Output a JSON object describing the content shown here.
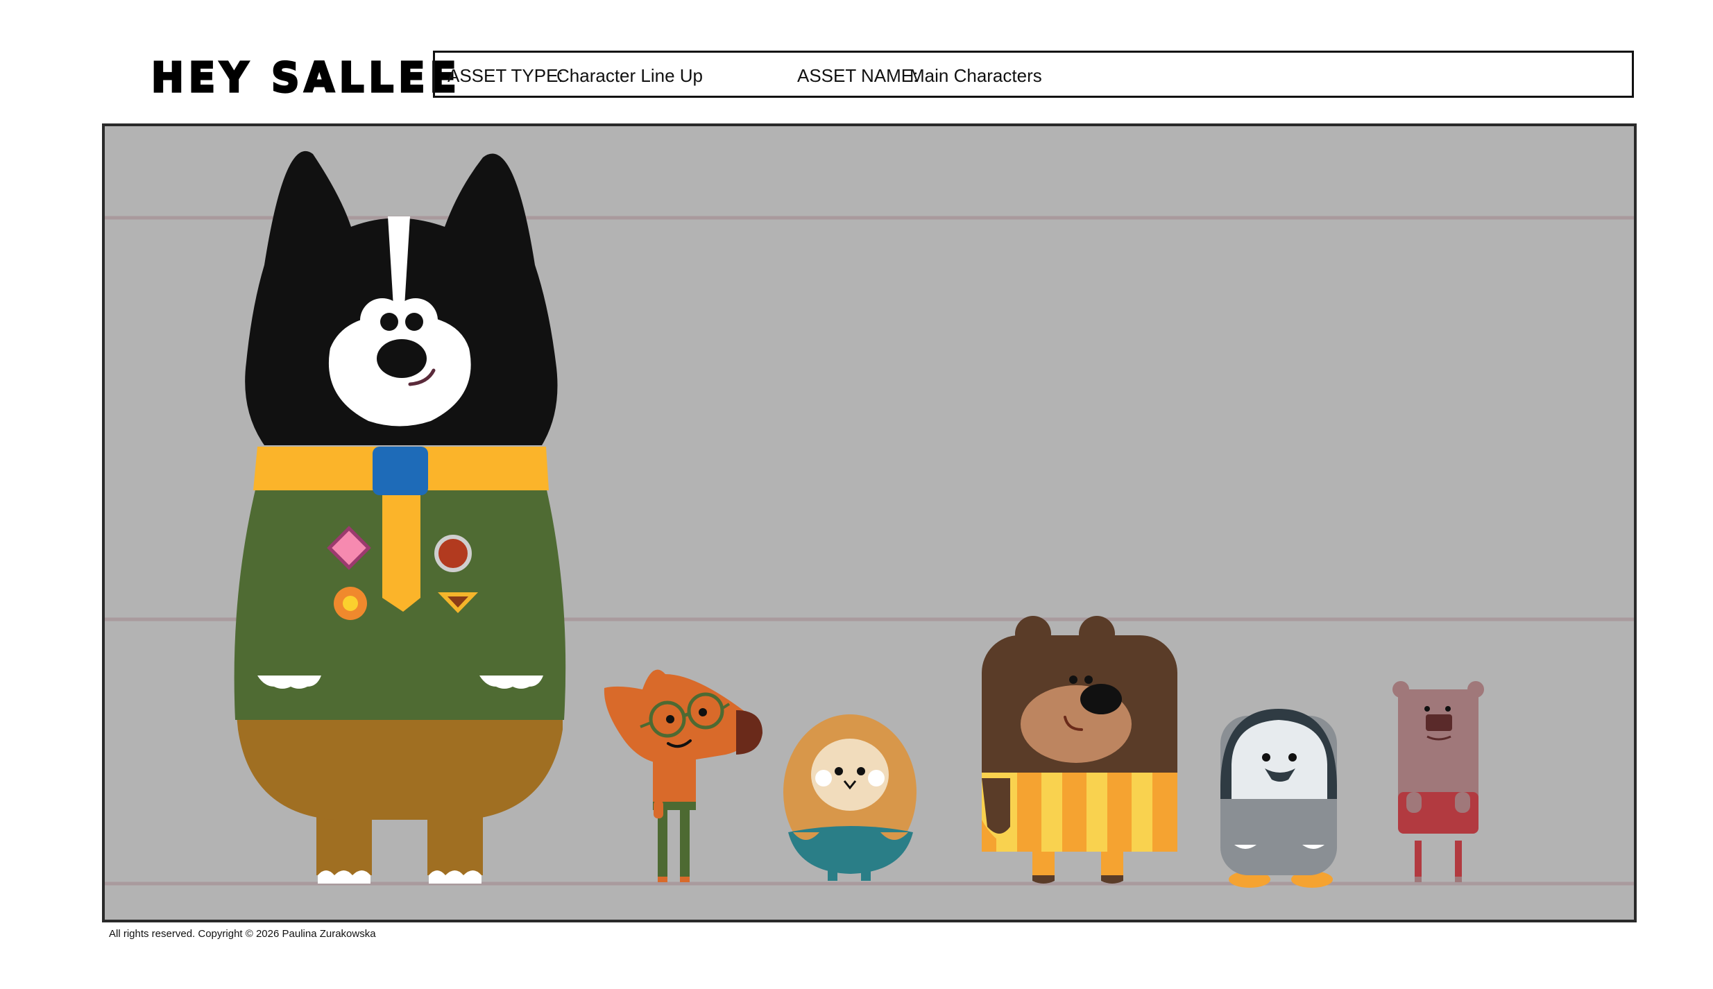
{
  "brand": {
    "logo_text": "HEY SALLEE"
  },
  "header": {
    "asset_type_label": "ASSET TYPE:",
    "asset_type_value": "Character Line Up",
    "asset_name_label": "ASSET NAME:",
    "asset_name_value": "Main Characters"
  },
  "footer": {
    "copyright": "All rights reserved. Copyright © 2026 Paulina Zurakowska"
  },
  "lineup": {
    "background": "#b3b3b3",
    "characters": [
      "dog",
      "fox",
      "owl",
      "bear",
      "penguin",
      "small-bear"
    ],
    "colors": {
      "dog_body": "#111111",
      "dog_sweater": "#4f6b33",
      "dog_scarf": "#fbb42a",
      "dog_woggle": "#1e6bb8",
      "dog_trousers": "#a06f22",
      "fox": "#d96a2a",
      "owl": "#d8974a",
      "bear": "#5a3c28",
      "bear_stripes": "#f9d24f",
      "penguin": "#2f3b43",
      "small_bear": "#a0787a"
    }
  }
}
